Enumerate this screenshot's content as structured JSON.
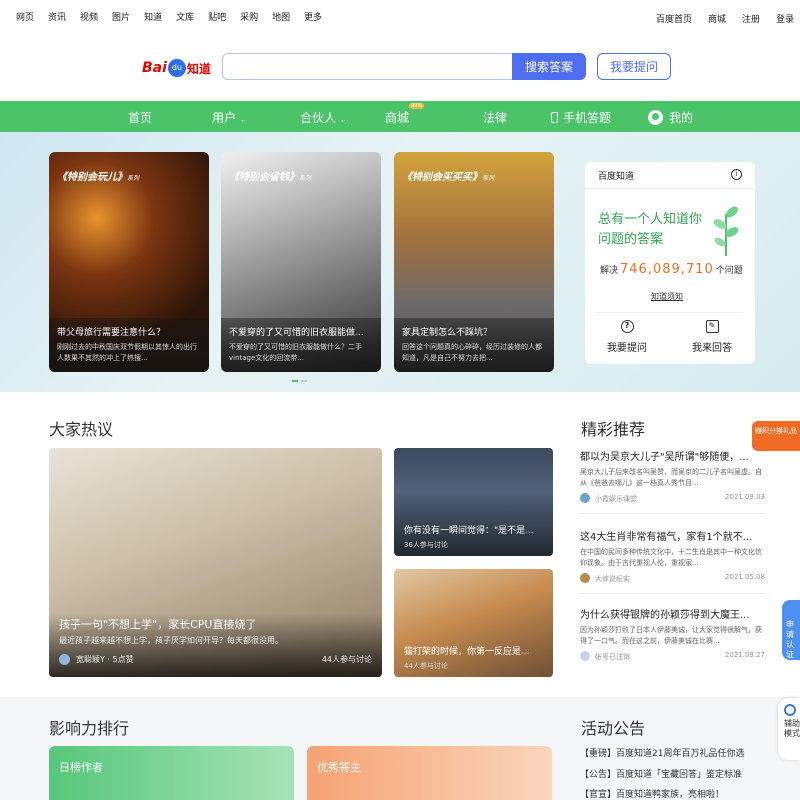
{
  "topnav": {
    "left": [
      "网页",
      "资讯",
      "视频",
      "图片",
      "知道",
      "文库",
      "贴吧",
      "采购",
      "地图",
      "更多"
    ],
    "right": [
      "百度首页",
      "商城",
      "注册",
      "登录"
    ]
  },
  "header": {
    "logo_bai": "Bai",
    "logo_du": "du",
    "logo_zhidao": "知道",
    "search_placeholder": "",
    "search_button": "搜索答案",
    "ask_button": "我要提问"
  },
  "greennav": {
    "home": "首页",
    "user": "用户",
    "partner": "合伙人",
    "mall": "商城",
    "mall_badge": "99%",
    "law": "法律",
    "mobile": "手机答题",
    "mine": "我的"
  },
  "banner": {
    "cards": [
      {
        "series": "《特别会玩儿》",
        "series_tag": "系列",
        "title": "带父母旅行需要注意什么？",
        "desc": "刚刚过去的中秋国庆双节假期以其惊人的出行人数果不其然的冲上了热搜..."
      },
      {
        "series": "《特别会省钱》",
        "series_tag": "系列",
        "title": "不爱穿的了又可惜的旧衣服能做...",
        "desc": "不爱穿的了又可惜的旧衣服能做什么？二手vintage文化的回流带..."
      },
      {
        "series": "《特别会买买买》",
        "series_tag": "系列",
        "title": "家具定制怎么不踩坑？",
        "desc": "回答这个问题真的心碎碎，经历过装修的人都知道，凡是自己不努力去把..."
      }
    ]
  },
  "panel": {
    "header": "百度知道",
    "info": "i",
    "slogan": "总有一个人知道你问题的答案",
    "solved_prefix": "解决",
    "solved_count": "746,089,710",
    "solved_suffix": "个问题",
    "notice": "知道须知",
    "ask": "我要提问",
    "answer": "我来回答"
  },
  "hot": {
    "title": "大家热议",
    "big": {
      "title": "孩子一句\"不想上学\"，家长CPU直接烧了",
      "desc": "最近孩子越来越不想上学，孩子厌学如何开导？每天都很没用。",
      "author": "宽聪颖Y · 5点赞",
      "count": "44人参与讨论"
    },
    "small": [
      {
        "title": "你有没有一瞬间觉得：\"是不是...",
        "count": "36人参与讨论"
      },
      {
        "title": "猫打架的时候，你第一反应是...",
        "count": "44人参与讨论"
      }
    ]
  },
  "recommend": {
    "title": "精彩推荐",
    "items": [
      {
        "title": "都以为吴京大儿子\"吴所谓\"够随便，...",
        "desc": "吴京大儿子后来改名叫吴赞，而吴京的二儿子名叫吴虚。自从《爸爸去哪儿》这一档真人秀节目...",
        "author": "小霞娱乐课堂",
        "date": "2021.09.03"
      },
      {
        "title": "这4大生肖非常有福气，家有1个就不...",
        "desc": "在中国的民间多种传统文化中，十二生肖是其中一种文化信仰现象。由于古代重视人伦，重视家...",
        "author": "大体说纪实",
        "date": "2021.05.08"
      },
      {
        "title": "为什么获得银牌的孙颖莎得到大魔王...",
        "desc": "因为孙颖莎打败了日本人伊藤美诚，让大家觉得很解气，获得了一口气。而在这之前，伊藤美诚在比赛...",
        "author": "帐号已注销",
        "date": "2021.09.27"
      }
    ]
  },
  "bottom": {
    "rank_title": "影响力排行",
    "rank_cards": [
      "日榜作者",
      "优秀答主"
    ],
    "ann_title": "活动公告",
    "ann": [
      "【重磅】百度知道21周年百万礼品任你选",
      "【公告】百度知道「宝藏回答」鉴定标准",
      "【官宣】百度知道鸭家族，亮相啦！"
    ]
  },
  "floats": {
    "points": "赚积分换礼品",
    "apply": "申请认证",
    "assist": "辅助模式"
  },
  "colors": {
    "green": "#4bc469",
    "blue": "#4e6ef2",
    "orange": "#ec6d20"
  }
}
